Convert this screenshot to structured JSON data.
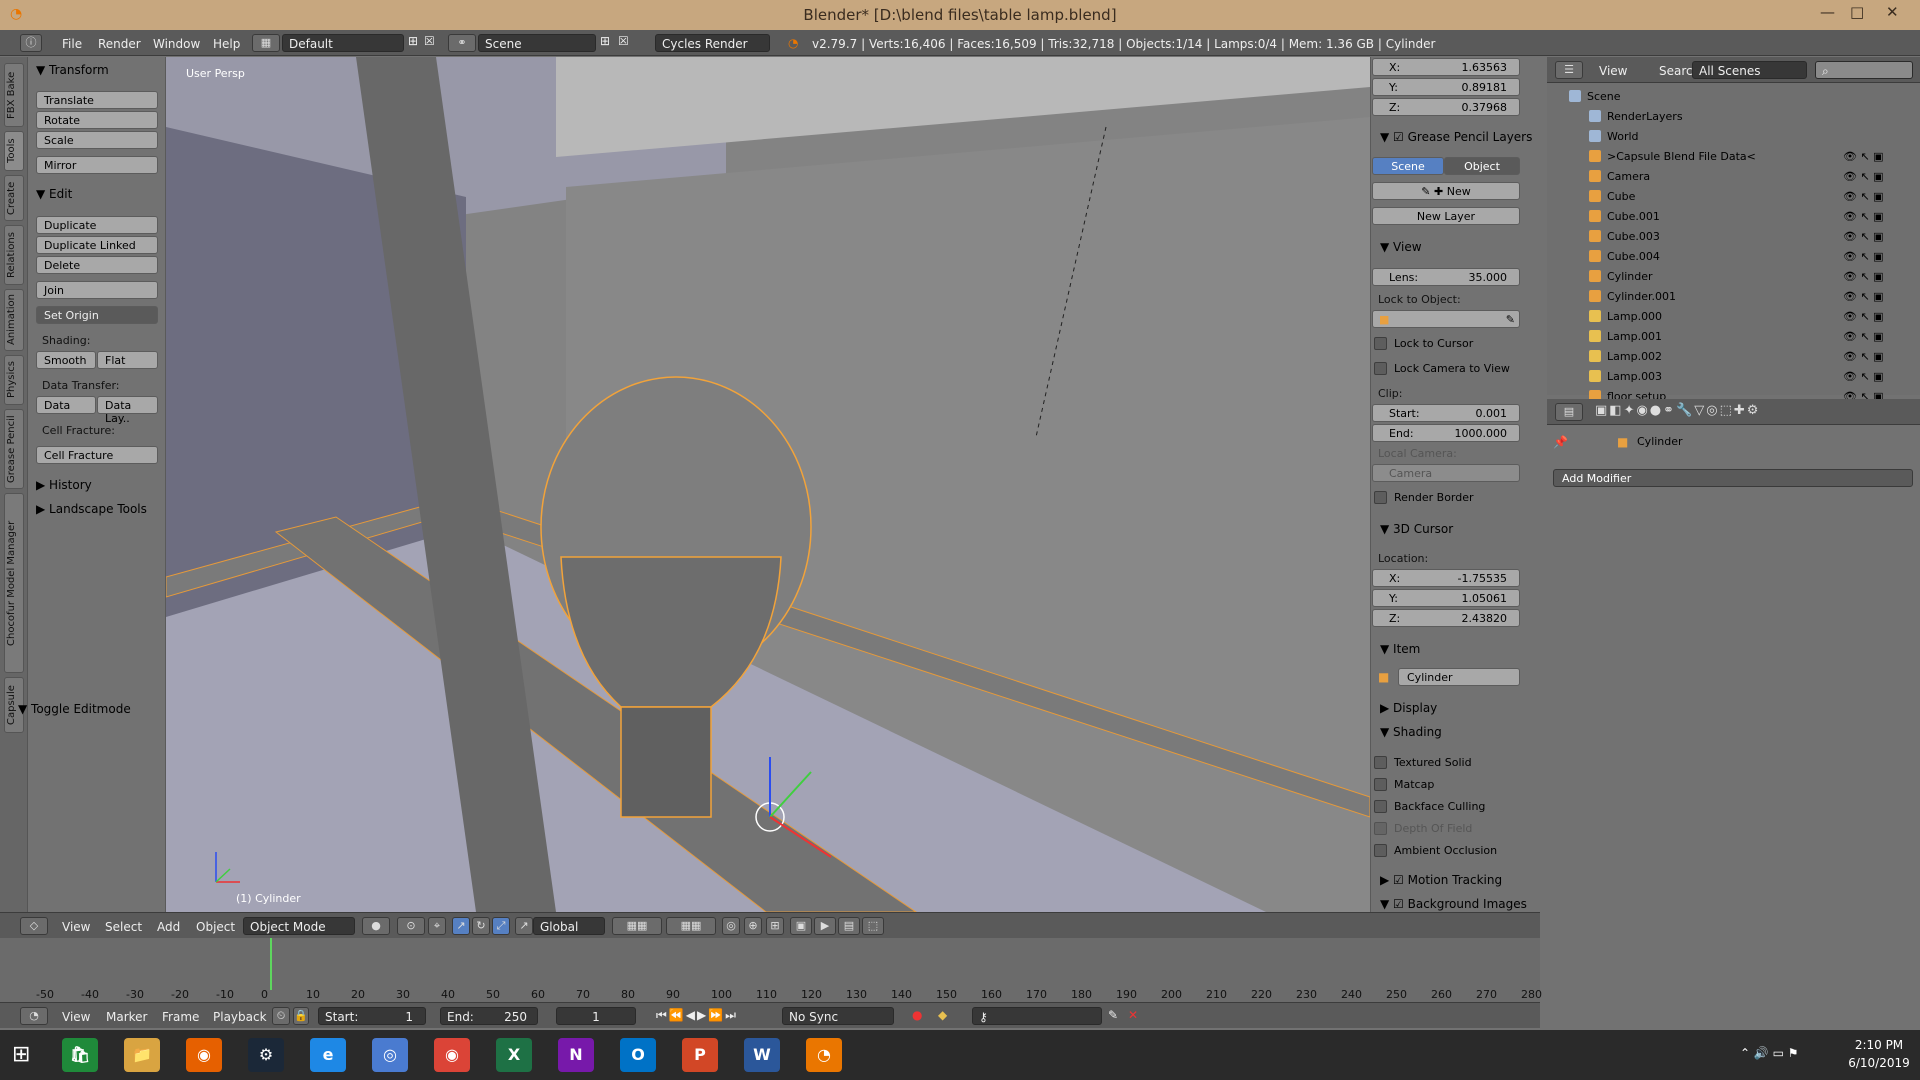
{
  "window": {
    "title": "Blender* [D:\\blend files\\table lamp.blend]"
  },
  "info": {
    "menus": [
      "File",
      "Render",
      "Window",
      "Help"
    ],
    "layout": "Default",
    "scene": "Scene",
    "engine": "Cycles Render",
    "stats": "v2.79.7 | Verts:16,406 | Faces:16,509 | Tris:32,718 | Objects:1/14 | Lamps:0/4 | Mem: 1.36 GB | Cylinder"
  },
  "tool_tabs": [
    "FBX Bake",
    "Tools",
    "Create",
    "Relations",
    "Animation",
    "Physics",
    "Grease Pencil",
    "Chocofur Model Manager",
    "Capsule"
  ],
  "toolshelf": {
    "transform": "Transform",
    "translate": "Translate",
    "rotate": "Rotate",
    "scale": "Scale",
    "mirror": "Mirror",
    "edit": "Edit",
    "duplicate": "Duplicate",
    "duplicate_linked": "Duplicate Linked",
    "delete": "Delete",
    "join": "Join",
    "set_origin": "Set Origin",
    "shading": "Shading:",
    "smooth": "Smooth",
    "flat": "Flat",
    "data_transfer": "Data Transfer:",
    "data": "Data",
    "data_lay": "Data Lay..",
    "cell_fracture_lbl": "Cell Fracture:",
    "cell_fracture": "Cell Fracture",
    "history": "History",
    "landscape": "Landscape Tools",
    "toggle_editmode": "Toggle Editmode"
  },
  "viewport": {
    "persp": "User Persp",
    "object": "(1) Cylinder"
  },
  "npanel": {
    "top": [
      {
        "axis": "X:",
        "value": "1.63563"
      },
      {
        "axis": "Y:",
        "value": "0.89181"
      },
      {
        "axis": "Z:",
        "value": "0.37968"
      }
    ],
    "grease_pencil": "Grease Pencil Layers",
    "gp_scene": "Scene",
    "gp_object": "Object",
    "gp_new": "New",
    "gp_new_layer": "New Layer",
    "view": "View",
    "lens_label": "Lens:",
    "lens_value": "35.000",
    "lock_to_object": "Lock to Object:",
    "lock_to_cursor": "Lock to Cursor",
    "lock_camera": "Lock Camera to View",
    "clip": "Clip:",
    "clip_start_label": "Start:",
    "clip_start": "0.001",
    "clip_end_label": "End:",
    "clip_end": "1000.000",
    "local_camera": "Local Camera:",
    "camera": "Camera",
    "render_border": "Render Border",
    "cursor": "3D Cursor",
    "location": "Location:",
    "cursor_loc": [
      {
        "axis": "X:",
        "value": "-1.75535"
      },
      {
        "axis": "Y:",
        "value": "1.05061"
      },
      {
        "axis": "Z:",
        "value": "2.43820"
      }
    ],
    "item": "Item",
    "item_name": "Cylinder",
    "display": "Display",
    "shading": "Shading",
    "textured_solid": "Textured Solid",
    "matcap": "Matcap",
    "backface": "Backface Culling",
    "dof": "Depth Of Field",
    "ao": "Ambient Occlusion",
    "motion_tracking": "Motion Tracking",
    "background_images": "Background Images"
  },
  "outliner": {
    "view": "View",
    "search": "Search",
    "filter": "All Scenes",
    "rows": [
      {
        "name": "Scene",
        "color": "#9fb7d6"
      },
      {
        "name": "RenderLayers",
        "color": "#9fb7d6"
      },
      {
        "name": "World",
        "color": "#9fb7d6"
      },
      {
        "name": ">Capsule Blend File Data<",
        "color": "#e8a040"
      },
      {
        "name": "Camera",
        "color": "#e8a040"
      },
      {
        "name": "Cube",
        "color": "#e8a040"
      },
      {
        "name": "Cube.001",
        "color": "#e8a040"
      },
      {
        "name": "Cube.003",
        "color": "#e8a040"
      },
      {
        "name": "Cube.004",
        "color": "#e8a040"
      },
      {
        "name": "Cylinder",
        "color": "#e8a040"
      },
      {
        "name": "Cylinder.001",
        "color": "#e8a040"
      },
      {
        "name": "Lamp.000",
        "color": "#e8c050"
      },
      {
        "name": "Lamp.001",
        "color": "#e8c050"
      },
      {
        "name": "Lamp.002",
        "color": "#e8c050"
      },
      {
        "name": "Lamp.003",
        "color": "#e8c050"
      },
      {
        "name": "floor setup",
        "color": "#e8a040"
      }
    ]
  },
  "properties": {
    "object": "Cylinder",
    "add_modifier": "Add Modifier"
  },
  "viewport_header": {
    "view": "View",
    "select": "Select",
    "add": "Add",
    "object": "Object",
    "mode": "Object Mode",
    "orientation": "Global"
  },
  "timeline": {
    "ticks": [
      "-50",
      "-40",
      "-30",
      "-20",
      "-10",
      "0",
      "10",
      "20",
      "30",
      "40",
      "50",
      "60",
      "70",
      "80",
      "90",
      "100",
      "110",
      "120",
      "130",
      "140",
      "150",
      "160",
      "170",
      "180",
      "190",
      "200",
      "210",
      "220",
      "230",
      "240",
      "250",
      "260",
      "270",
      "280"
    ],
    "view": "View",
    "marker": "Marker",
    "frame": "Frame",
    "playback": "Playback",
    "start_label": "Start:",
    "start": "1",
    "end_label": "End:",
    "end": "250",
    "current": "1",
    "sync": "No Sync"
  },
  "taskbar": {
    "time": "2:10 PM",
    "date": "6/10/2019",
    "apps": [
      {
        "name": "store",
        "glyph": "🛍",
        "color": "#1f8a3a"
      },
      {
        "name": "explorer",
        "glyph": "📁",
        "color": "#d9a441"
      },
      {
        "name": "firefox",
        "glyph": "◉",
        "color": "#e66000"
      },
      {
        "name": "steam",
        "glyph": "⚙",
        "color": "#1b2838"
      },
      {
        "name": "edge",
        "glyph": "e",
        "color": "#1e88e5"
      },
      {
        "name": "chromium",
        "glyph": "◎",
        "color": "#4a7bd0"
      },
      {
        "name": "chrome",
        "glyph": "◉",
        "color": "#db4437"
      },
      {
        "name": "excel",
        "glyph": "X",
        "color": "#1e7145"
      },
      {
        "name": "onenote",
        "glyph": "N",
        "color": "#7719aa"
      },
      {
        "name": "outlook",
        "glyph": "O",
        "color": "#0072c6"
      },
      {
        "name": "powerpoint",
        "glyph": "P",
        "color": "#d24726"
      },
      {
        "name": "word",
        "glyph": "W",
        "color": "#2b579a"
      },
      {
        "name": "blender",
        "glyph": "◔",
        "color": "#ea7600"
      }
    ]
  },
  "colors": {
    "selection": "#f2a33a",
    "accent": "#5680c2"
  }
}
